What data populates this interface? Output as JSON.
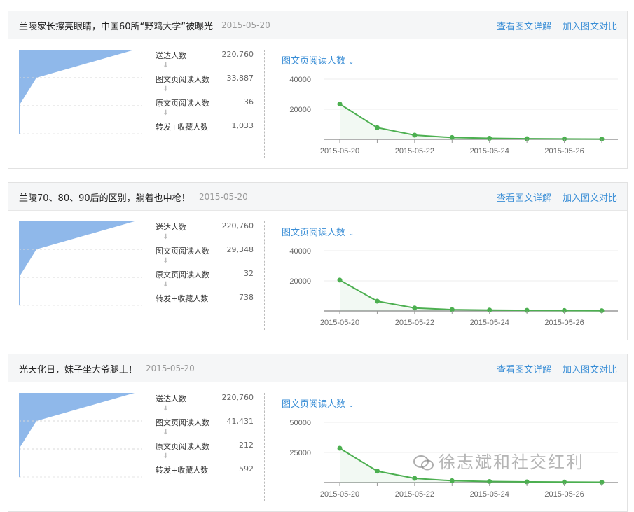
{
  "articles": [
    {
      "title": "兰陵家长擦亮眼睛，中国60所“野鸡大学”被曝光",
      "date": "2015-05-20",
      "links": {
        "detail": "查看图文详解",
        "compare": "加入图文对比"
      },
      "stats": [
        {
          "label": "送达人数",
          "value": "220,760"
        },
        {
          "label": "图文页阅读人数",
          "value": "33,887"
        },
        {
          "label": "原文页阅读人数",
          "value": "36"
        },
        {
          "label": "转发+收藏人数",
          "value": "1,033"
        }
      ],
      "metric_selector": "图文页阅读人数",
      "chart_data": {
        "type": "line",
        "x": [
          "2015-05-20",
          "2015-05-21",
          "2015-05-22",
          "2015-05-23",
          "2015-05-24",
          "2015-05-25",
          "2015-05-26",
          "2015-05-27"
        ],
        "xticks": [
          "2015-05-20",
          "2015-05-22",
          "2015-05-24",
          "2015-05-26"
        ],
        "values": [
          23500,
          7800,
          2800,
          1200,
          700,
          400,
          300,
          200
        ],
        "ylim": [
          0,
          40000
        ],
        "yticks": [
          "20000",
          "40000"
        ],
        "color": "#4caf50"
      }
    },
    {
      "title": "兰陵70、80、90后的区别，躺着也中枪！",
      "date": "2015-05-20",
      "links": {
        "detail": "查看图文详解",
        "compare": "加入图文对比"
      },
      "stats": [
        {
          "label": "送达人数",
          "value": "220,760"
        },
        {
          "label": "图文页阅读人数",
          "value": "29,348"
        },
        {
          "label": "原文页阅读人数",
          "value": "32"
        },
        {
          "label": "转发+收藏人数",
          "value": "738"
        }
      ],
      "metric_selector": "图文页阅读人数",
      "chart_data": {
        "type": "line",
        "x": [
          "2015-05-20",
          "2015-05-21",
          "2015-05-22",
          "2015-05-23",
          "2015-05-24",
          "2015-05-25",
          "2015-05-26",
          "2015-05-27"
        ],
        "xticks": [
          "2015-05-20",
          "2015-05-22",
          "2015-05-24",
          "2015-05-26"
        ],
        "values": [
          20500,
          6500,
          2000,
          900,
          600,
          400,
          300,
          200
        ],
        "ylim": [
          0,
          40000
        ],
        "yticks": [
          "20000",
          "40000"
        ],
        "color": "#4caf50"
      }
    },
    {
      "title": "光天化日，妹子坐大爷腿上！",
      "date": "2015-05-20",
      "links": {
        "detail": "查看图文详解",
        "compare": "加入图文对比"
      },
      "stats": [
        {
          "label": "送达人数",
          "value": "220,760"
        },
        {
          "label": "图文页阅读人数",
          "value": "41,431"
        },
        {
          "label": "原文页阅读人数",
          "value": "212"
        },
        {
          "label": "转发+收藏人数",
          "value": "592"
        }
      ],
      "metric_selector": "图文页阅读人数",
      "chart_data": {
        "type": "line",
        "x": [
          "2015-05-20",
          "2015-05-21",
          "2015-05-22",
          "2015-05-23",
          "2015-05-24",
          "2015-05-25",
          "2015-05-26",
          "2015-05-27"
        ],
        "xticks": [
          "2015-05-20",
          "2015-05-22",
          "2015-05-24",
          "2015-05-26"
        ],
        "values": [
          28500,
          9500,
          3500,
          1500,
          900,
          600,
          400,
          300
        ],
        "ylim": [
          0,
          50000
        ],
        "yticks": [
          "25000",
          "50000"
        ],
        "color": "#4caf50"
      }
    }
  ],
  "funnel_color": "#8fb8ea",
  "watermark": "徐志斌和社交红利",
  "icons": {
    "arrow": "down-arrow-icon",
    "chevron": "chevron-down-icon",
    "watermark": "wechat-icon"
  }
}
